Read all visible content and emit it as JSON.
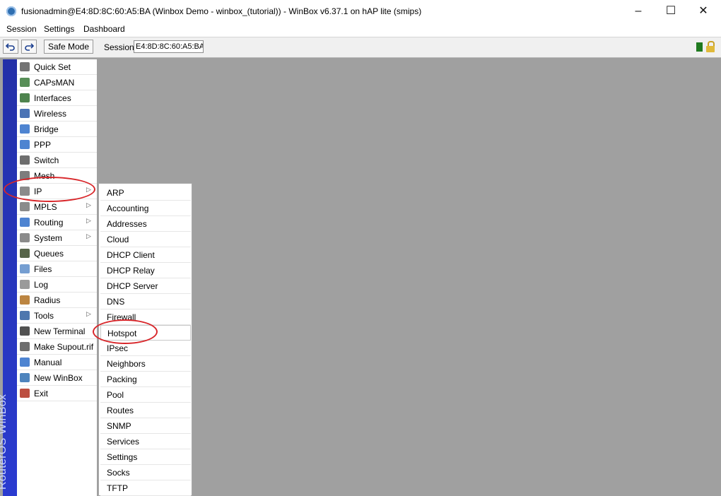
{
  "window": {
    "title": "fusionadmin@E4:8D:8C:60:A5:BA (Winbox Demo - winbox_(tutorial)) - WinBox v6.37.1 on hAP lite (smips)",
    "app_icon": "winbox-globe-icon",
    "controls": {
      "minimize": "–",
      "maximize": "☐",
      "close": "✕"
    }
  },
  "menubar": {
    "items": [
      "Session",
      "Settings",
      "Dashboard"
    ]
  },
  "toolbar": {
    "undo_icon": "undo-icon",
    "redo_icon": "redo-icon",
    "safe_mode_label": "Safe Mode",
    "session_label": "Session:",
    "session_value": "E4:8D:8C:60:A5:BA",
    "status_color": "#1f7a1f"
  },
  "sidebar": {
    "brand": "RouterOS WinBox"
  },
  "main_menu": {
    "items": [
      {
        "label": "Quick Set",
        "icon": "quick-set-icon"
      },
      {
        "label": "CAPsMAN",
        "icon": "capsman-icon"
      },
      {
        "label": "Interfaces",
        "icon": "interfaces-icon"
      },
      {
        "label": "Wireless",
        "icon": "wireless-icon"
      },
      {
        "label": "Bridge",
        "icon": "bridge-icon"
      },
      {
        "label": "PPP",
        "icon": "ppp-icon"
      },
      {
        "label": "Switch",
        "icon": "switch-icon"
      },
      {
        "label": "Mesh",
        "icon": "mesh-icon"
      },
      {
        "label": "IP",
        "icon": "ip-icon",
        "submenu": true
      },
      {
        "label": "MPLS",
        "icon": "mpls-icon",
        "submenu": true
      },
      {
        "label": "Routing",
        "icon": "routing-icon",
        "submenu": true
      },
      {
        "label": "System",
        "icon": "system-gear-icon",
        "submenu": true
      },
      {
        "label": "Queues",
        "icon": "queues-icon"
      },
      {
        "label": "Files",
        "icon": "files-folder-icon"
      },
      {
        "label": "Log",
        "icon": "log-icon"
      },
      {
        "label": "Radius",
        "icon": "radius-icon"
      },
      {
        "label": "Tools",
        "icon": "tools-icon",
        "submenu": true
      },
      {
        "label": "New Terminal",
        "icon": "terminal-icon"
      },
      {
        "label": "Make Supout.rif",
        "icon": "supout-icon"
      },
      {
        "label": "Manual",
        "icon": "manual-help-icon"
      },
      {
        "label": "New WinBox",
        "icon": "new-winbox-icon"
      },
      {
        "label": "Exit",
        "icon": "exit-door-icon"
      }
    ]
  },
  "ip_submenu": {
    "items": [
      "ARP",
      "Accounting",
      "Addresses",
      "Cloud",
      "DHCP Client",
      "DHCP Relay",
      "DHCP Server",
      "DNS",
      "Firewall",
      "Hotspot",
      "IPsec",
      "Neighbors",
      "Packing",
      "Pool",
      "Routes",
      "SNMP",
      "Services",
      "Settings",
      "Socks",
      "TFTP"
    ]
  },
  "annotation_color": "#d8262a"
}
